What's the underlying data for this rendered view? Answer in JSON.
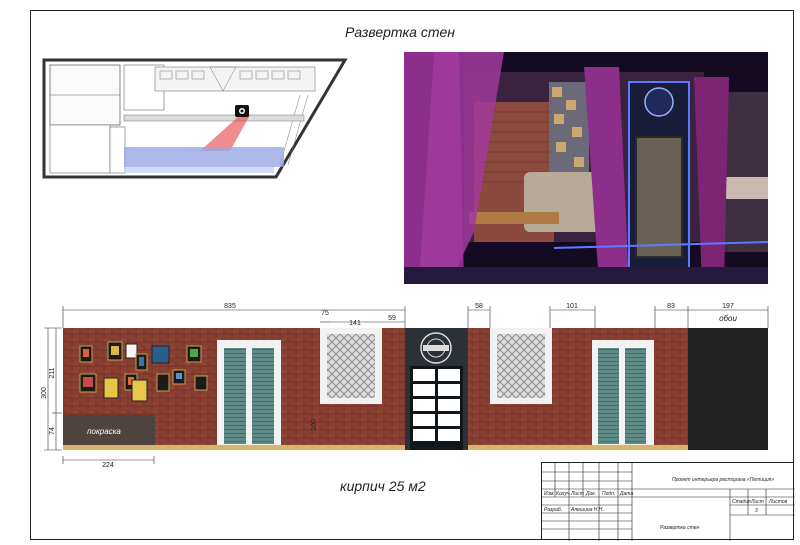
{
  "title": "Развертка стен",
  "caption": "кирпич 25 м2",
  "labels": {
    "paint": "покраска",
    "wallpaper": "обои"
  },
  "dimensions": {
    "d835": "835",
    "d75": "75",
    "d141": "141",
    "d59": "59",
    "d58": "58",
    "d101": "101",
    "d83": "83",
    "d197": "197",
    "d300": "300",
    "d211": "211",
    "d74": "74",
    "d224": "224",
    "d100": "100"
  },
  "stamp": {
    "project": "Проект интерьера ресторана «Петиция»",
    "headers": [
      "Изм.",
      "Колуч.",
      "Лист",
      "Док.",
      "Подп.",
      "Дата"
    ],
    "developer_role": "Разраб.",
    "developer_name": "Алешина Н.Н.",
    "sheet_title": "Развертка стен",
    "stage_label": "Стадия",
    "sheet_label": "Лист",
    "sheets_label": "Листов",
    "sheet_value": "3"
  },
  "colors": {
    "brick": "#8a3f33",
    "window_frame": "#f2f2f2",
    "shutter": "#5f8a85",
    "door": "#2b3136",
    "wallpaper": "#222222",
    "floor": "#d9b56b",
    "paint_panel": "#4d433f",
    "render_purple": "#8d2f8a"
  }
}
